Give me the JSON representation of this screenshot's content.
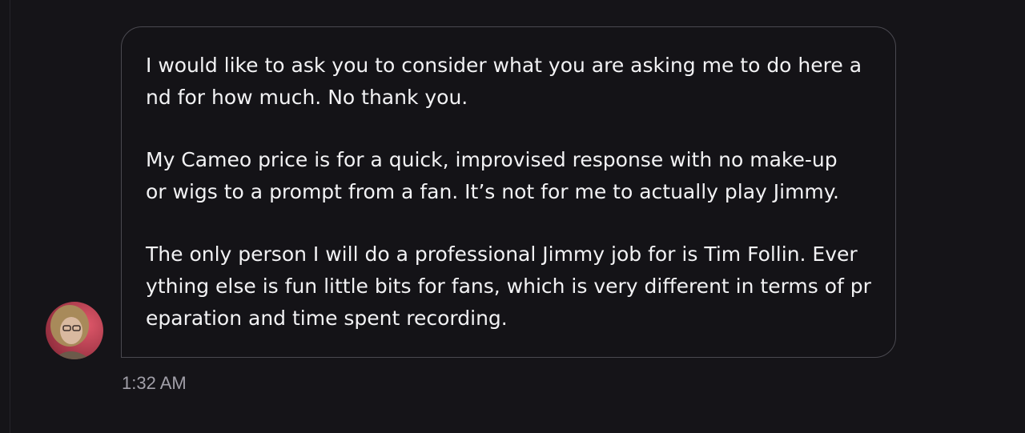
{
  "message": {
    "paragraphs": [
      "I would like to ask you to consider what you are asking me to do here a\nnd for how much. No thank you.",
      "My Cameo price is for a quick, improvised response with no make-up\nor wigs to a prompt from a fan. It’s not for me to actually play Jimmy.",
      "The only person I will do a professional Jimmy job for is Tim Follin. Ever\nything else is fun little bits for fans, which is very different in terms of pr\neparation and time spent recording."
    ],
    "timestamp": "1:32 AM"
  },
  "colors": {
    "background": "#151418",
    "bubble_border": "#4a4950",
    "text": "#f2f2f4",
    "timestamp": "#a19fa8"
  }
}
